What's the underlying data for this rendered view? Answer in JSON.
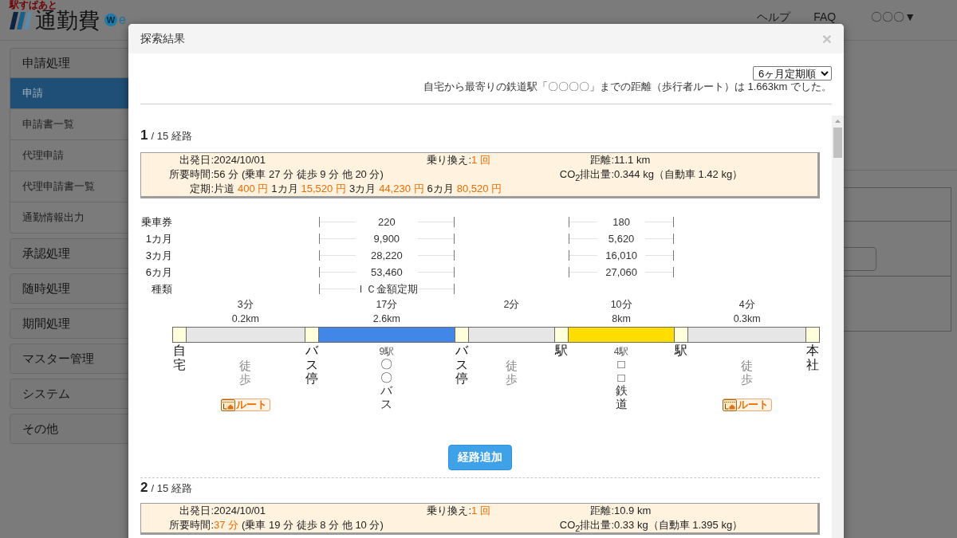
{
  "header": {
    "logo_caption": "駅すぱあと",
    "logo_title": "通勤費",
    "logo_badge": "W",
    "logo_suffix": "e",
    "nav": [
      "ヘルプ",
      "FAQ",
      "〇〇〇▼"
    ]
  },
  "sidebar": {
    "groups": [
      {
        "label": "申請処理",
        "items": [
          {
            "label": "申請",
            "selected": true
          },
          {
            "label": "申請書一覧",
            "selected": false
          },
          {
            "label": "代理申請",
            "selected": false
          },
          {
            "label": "代理申請書一覧",
            "selected": false
          },
          {
            "label": "通勤情報出力",
            "selected": false
          }
        ]
      },
      {
        "label": "承認処理"
      },
      {
        "label": "随時処理"
      },
      {
        "label": "期間処理"
      },
      {
        "label": "マスター管理"
      },
      {
        "label": "システム"
      },
      {
        "label": "その他"
      }
    ]
  },
  "modal": {
    "title": "探索結果",
    "close": "×",
    "sort": "6ヶ月定期順",
    "note": "自宅から最寄りの鉄道駅「〇〇〇〇」までの距離（歩行者ルート）は 1.663km でした。",
    "routes": [
      {
        "number": "1",
        "count": "/ 15 経路",
        "summary": {
          "departure": {
            "label": "出発日:",
            "value": "2024/10/01"
          },
          "transfers": {
            "label": "乗り換え:",
            "value": "1 回"
          },
          "distance": {
            "label": "距離:",
            "value": "11.1 km"
          },
          "duration": {
            "label": "所要時間:",
            "value": "56 分",
            "highlighted": false,
            "detail": "(乗車 27 分 徒歩 9 分 他 20 分)"
          },
          "co2": {
            "label": "CO$_{2}$排出量:",
            "value": "0.344 kg（自動車 1.42 kg）"
          },
          "pass": {
            "label": "定期:",
            "fares": [
              {
                "term": "片道",
                "price": "400 円"
              },
              {
                "term": "1カ月",
                "price": "15,520 円"
              },
              {
                "term": "3カ月",
                "price": "44,230 円"
              },
              {
                "term": "6カ月",
                "price": "80,520 円"
              }
            ]
          }
        },
        "fare_labels": [
          "乗車券",
          "1カ月",
          "3カ月",
          "6カ月",
          "種類"
        ],
        "stops": [
          {
            "name": "自宅"
          },
          {
            "name": "バス停"
          },
          {
            "name": "バス停"
          },
          {
            "name": "駅"
          },
          {
            "name": "駅"
          },
          {
            "name": "本社"
          }
        ],
        "segments": [
          {
            "kind": "walk",
            "color": "#e6e6e6",
            "time": "3分",
            "distance": "0.2km",
            "label": "徒歩",
            "link": "ルート"
          },
          {
            "kind": "bus",
            "color": "#4287e7",
            "time": "17分",
            "distance": "2.6km",
            "stations": "9駅",
            "label": "〇〇バス",
            "fares": [
              "220",
              "9,900",
              "28,220",
              "53,460",
              "ＩＣ金額定期"
            ]
          },
          {
            "kind": "walk",
            "color": "#e6e6e6",
            "time": "2分",
            "label": "徒歩"
          },
          {
            "kind": "rail",
            "color": "#ffdd00",
            "time": "10分",
            "distance": "8km",
            "stations": "4駅",
            "label": "□□鉄道",
            "fares": [
              "180",
              "5,620",
              "16,010",
              "27,060"
            ]
          },
          {
            "kind": "walk",
            "color": "#e6e6e6",
            "time": "4分",
            "distance": "0.3km",
            "label": "徒歩",
            "link": "ルート"
          }
        ],
        "add_button": "経路追加"
      },
      {
        "number": "2",
        "count": "/ 15 経路",
        "summary": {
          "departure": {
            "label": "出発日:",
            "value": "2024/10/01"
          },
          "transfers": {
            "label": "乗り換え:",
            "value": "1 回"
          },
          "distance": {
            "label": "距離:",
            "value": "10.9 km"
          },
          "duration": {
            "label": "所要時間:",
            "value": "37 分",
            "highlighted": true,
            "detail": "(乗車 19 分 徒歩 8 分 他 10 分)"
          },
          "co2": {
            "label": "CO$_{2}$排出量:",
            "value": "0.33 kg（自動車 1.395 kg）"
          }
        }
      }
    ]
  }
}
